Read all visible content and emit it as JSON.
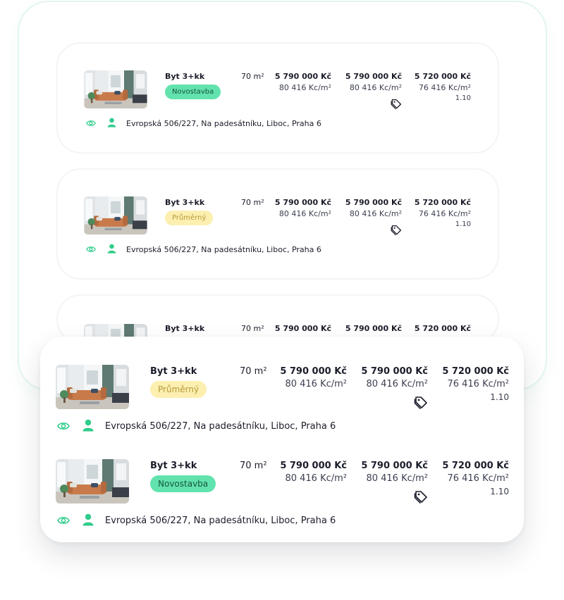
{
  "colors": {
    "accent": "#2fcc8a",
    "badge_new": "#62e3ad",
    "badge_avg": "#fcefb0"
  },
  "icons": {
    "view": "eye-icon",
    "owner": "person-icon",
    "discount": "price-tag-icon"
  },
  "listings": [
    {
      "title": "Byt 3+kk",
      "badge": "Novostavba",
      "area": "70 m²",
      "price1": "5 790 000 Kč",
      "ppm1": "80 416 Kc/m²",
      "price2": "5 790 000 Kč",
      "ppm2": "80 416 Kc/m²",
      "price3": "5 720 000 Kč",
      "ppm3": "76 416 Kc/m²",
      "ratio": "1.10",
      "address": "Evropská 506/227, Na padesátníku, Liboc, Praha 6"
    },
    {
      "title": "Byt 3+kk",
      "badge": "Průměrný",
      "area": "70 m²",
      "price1": "5 790 000 Kč",
      "ppm1": "80 416 Kc/m²",
      "price2": "5 790 000 Kč",
      "ppm2": "80 416 Kc/m²",
      "price3": "5 720 000 Kč",
      "ppm3": "76 416 Kc/m²",
      "ratio": "1.10",
      "address": "Evropská 506/227, Na padesátníku, Liboc, Praha 6"
    },
    {
      "title": "Byt 3+kk",
      "area": "70 m²",
      "price1": "5 790 000 Kč",
      "price2": "5 790 000 Kč",
      "price3": "5 720 000 Kč"
    }
  ],
  "highlighted": [
    {
      "title": "Byt 3+kk",
      "badge": "Průměrný",
      "area": "70 m²",
      "price1": "5 790 000 Kč",
      "ppm1": "80 416 Kc/m²",
      "price2": "5 790 000 Kč",
      "ppm2": "80 416 Kc/m²",
      "price3": "5 720 000 Kč",
      "ppm3": "76 416 Kc/m²",
      "ratio": "1.10",
      "address": "Evropská 506/227, Na padesátníku, Liboc, Praha 6"
    },
    {
      "title": "Byt 3+kk",
      "badge": "Novostavba",
      "area": "70 m²",
      "price1": "5 790 000 Kč",
      "ppm1": "80 416 Kc/m²",
      "price2": "5 790 000 Kč",
      "ppm2": "80 416 Kc/m²",
      "price3": "5 720 000 Kč",
      "ppm3": "76 416 Kc/m²",
      "ratio": "1.10",
      "address": "Evropská 506/227, Na padesátníku, Liboc, Praha 6"
    }
  ]
}
